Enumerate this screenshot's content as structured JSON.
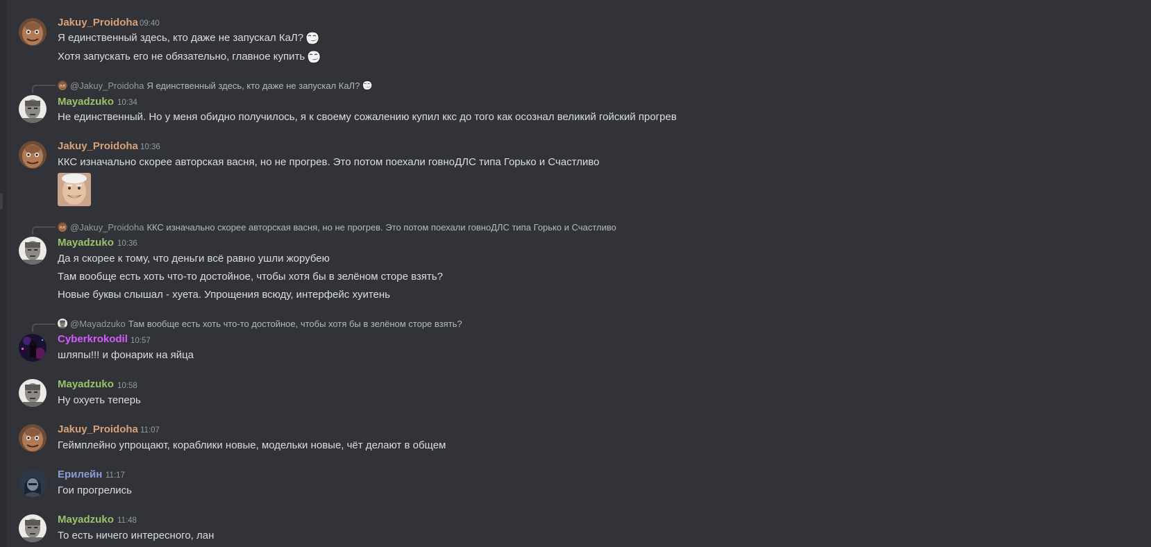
{
  "colors": {
    "background": "#313338",
    "jakuy": "#d9a177",
    "mayadzuko": "#9ac46a",
    "cyber": "#d65bff",
    "erilein": "#8b9fd6",
    "muted": "#949ba4"
  },
  "messages": [
    {
      "author": "Jakuy_Proidoha",
      "time": "09:40",
      "avatar_icon": "jakuy-avatar-icon",
      "lines": [
        {
          "text": "Я единственный здесь, кто даже не запускал КаЛ?",
          "emoji": "troll-face-emoji"
        },
        {
          "text": "Хотя запускать его не обязательно, главное купить",
          "emoji": "troll-face-emoji"
        }
      ]
    },
    {
      "reply": {
        "name": "@Jakuy_Proidoha",
        "text": "Я единственный здесь, кто даже не запускал КаЛ?",
        "emoji": "troll-face-emoji"
      },
      "author": "Mayadzuko",
      "time": "10:34",
      "avatar_icon": "mayadzuko-avatar-icon",
      "lines": [
        {
          "text": "Не единственный. Но у меня обидно получилось, я к своему сожалению купил ккс до того как осознал великий гойский прогрев"
        }
      ]
    },
    {
      "author": "Jakuy_Proidoha",
      "time": "10:36",
      "avatar_icon": "jakuy-avatar-icon",
      "lines": [
        {
          "text": "ККС изначально скорее авторская васня, но не прогрев. Это потом поехали говноДЛС типа Горько и Счастливо"
        }
      ],
      "attachment": "smiling-old-man-image"
    },
    {
      "reply": {
        "name": "@Jakuy_Proidoha",
        "text": "ККС изначально скорее авторская васня, но не прогрев. Это потом поехали говноДЛС типа Горько и Счастливо"
      },
      "author": "Mayadzuko",
      "time": "10:36",
      "avatar_icon": "mayadzuko-avatar-icon",
      "lines": [
        {
          "text": "Да я скорее к тому, что деньги всё равно ушли жорубею"
        },
        {
          "text": "Там вообще есть хоть что-то достойное, чтобы хотя бы в зелёном сторе взять?"
        },
        {
          "text": "Новые буквы слышал - хуета. Упрощения всюду, интерфейс хуитень"
        }
      ]
    },
    {
      "reply": {
        "name": "@Mayadzuko",
        "text": "Там вообще есть хоть что-то достойное, чтобы хотя бы в зелёном сторе взять?"
      },
      "author": "Cyberkrokodil",
      "time": "10:57",
      "avatar_icon": "cyberkrokodil-avatar-icon",
      "lines": [
        {
          "text": "шляпы!!! и фонарик на яйца"
        }
      ]
    },
    {
      "author": "Mayadzuko",
      "time": "10:58",
      "avatar_icon": "mayadzuko-avatar-icon",
      "lines": [
        {
          "text": "Ну охуеть теперь"
        }
      ]
    },
    {
      "author": "Jakuy_Proidoha",
      "time": "11:07",
      "avatar_icon": "jakuy-avatar-icon",
      "lines": [
        {
          "text": "Геймплейно упрощают, кораблики новые, модельки новые, чёт делают в общем"
        }
      ]
    },
    {
      "author": "Ерилейн",
      "time": "11:17",
      "avatar_icon": "erilein-avatar-icon",
      "lines": [
        {
          "text": "Гои прогрелись"
        }
      ]
    },
    {
      "author": "Mayadzuko",
      "time": "11:48",
      "avatar_icon": "mayadzuko-avatar-icon",
      "lines": [
        {
          "text": "То есть ничего интересного, лан"
        }
      ]
    }
  ]
}
